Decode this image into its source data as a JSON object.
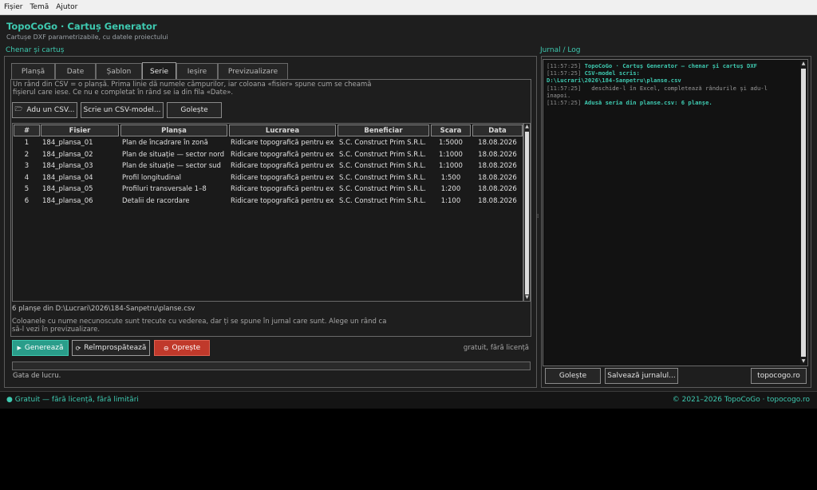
{
  "menubar": {
    "items": [
      "Fișier",
      "Temă",
      "Ajutor"
    ]
  },
  "header": {
    "title": "TopoCoGo · Cartuș Generator",
    "subtitle": "Cartușe DXF parametrizabile, cu datele proiectului"
  },
  "left_section": {
    "label": "Chenar și cartuș"
  },
  "right_section": {
    "label": "Jurnal / Log"
  },
  "tabs": [
    {
      "label": "Planșă"
    },
    {
      "label": "Date"
    },
    {
      "label": "Șablon"
    },
    {
      "label": "Serie"
    },
    {
      "label": "Ieșire"
    },
    {
      "label": "Previzualizare"
    }
  ],
  "active_tab": "Serie",
  "serie": {
    "hint_top_1": "Un rând din CSV = o planșă. Prima linie dă numele câmpurilor, iar coloana «fisier» spune cum se cheamă",
    "hint_top_2": "fișierul care iese. Ce nu e completat în rând se ia din fila «Date».",
    "btn_load": "Adu un CSV...",
    "btn_write": "Scrie un CSV-model...",
    "btn_clear": "Golește",
    "columns": [
      "#",
      "Fisier",
      "Planșa",
      "Lucrarea",
      "Beneficiar",
      "Scara",
      "Data"
    ],
    "rows": [
      [
        "1",
        "184_plansa_01",
        "Plan de încadrare în zonă",
        "Ridicare topografică pentru ex",
        "S.C. Construct Prim S.R.L.",
        "1:5000",
        "18.08.2026"
      ],
      [
        "2",
        "184_plansa_02",
        "Plan de situație — sector nord",
        "Ridicare topografică pentru ex",
        "S.C. Construct Prim S.R.L.",
        "1:1000",
        "18.08.2026"
      ],
      [
        "3",
        "184_plansa_03",
        "Plan de situație — sector sud",
        "Ridicare topografică pentru ex",
        "S.C. Construct Prim S.R.L.",
        "1:1000",
        "18.08.2026"
      ],
      [
        "4",
        "184_plansa_04",
        "Profil longitudinal",
        "Ridicare topografică pentru ex",
        "S.C. Construct Prim S.R.L.",
        "1:500",
        "18.08.2026"
      ],
      [
        "5",
        "184_plansa_05",
        "Profiluri transversale 1–8",
        "Ridicare topografică pentru ex",
        "S.C. Construct Prim S.R.L.",
        "1:200",
        "18.08.2026"
      ],
      [
        "6",
        "184_plansa_06",
        "Detalii de racordare",
        "Ridicare topografică pentru ex",
        "S.C. Construct Prim S.R.L.",
        "1:100",
        "18.08.2026"
      ]
    ],
    "source_info": "6 planșe din D:\\Lucrari\\2026\\184-Sanpetru\\planse.csv",
    "hint_bottom_1": "Coloanele cu nume necunoscute sunt trecute cu vederea, dar ți se spune în jurnal care sunt. Alege un rând ca",
    "hint_bottom_2": "să-l vezi în previzualizare."
  },
  "actions": {
    "generate": "Generează",
    "refresh": "Reîmprospătează",
    "stop": "Oprește",
    "license_note": "gratuit, fără licență"
  },
  "progress": {
    "value": 0
  },
  "status": {
    "text": "Gata de lucru."
  },
  "log": {
    "lines": [
      {
        "ts": "[11:57:25]",
        "text": "TopoCoGo · Cartuș Generator — chenar și cartuș DXF",
        "style": "hl"
      },
      {
        "ts": "[11:57:25]",
        "text": "CSV-model scris:",
        "style": "hl"
      },
      {
        "ts": "",
        "text": "D:\\Lucrari\\2026\\184-Sanpetru\\planse.csv",
        "style": "hl"
      },
      {
        "ts": "[11:57:25]",
        "text": "  deschide-l în Excel, completează rândurile și adu-l",
        "style": "dim"
      },
      {
        "ts": "",
        "text": "înapoi.",
        "style": "dim"
      },
      {
        "ts": "[11:57:25]",
        "text": "Adusă seria din planse.csv: 6 planșe.",
        "style": "hl"
      }
    ],
    "btn_clear": "Golește",
    "btn_save": "Salvează jurnalul...",
    "btn_site": "topocogo.ro"
  },
  "statusbar": {
    "left": "Gratuit — fără licență, fără limitări",
    "right": "© 2021–2026 TopoCoGo · topocogo.ro"
  },
  "colors": {
    "accent": "#3ec9b0",
    "generate_bg": "#2a9d8a",
    "stop_bg": "#c0392b"
  }
}
